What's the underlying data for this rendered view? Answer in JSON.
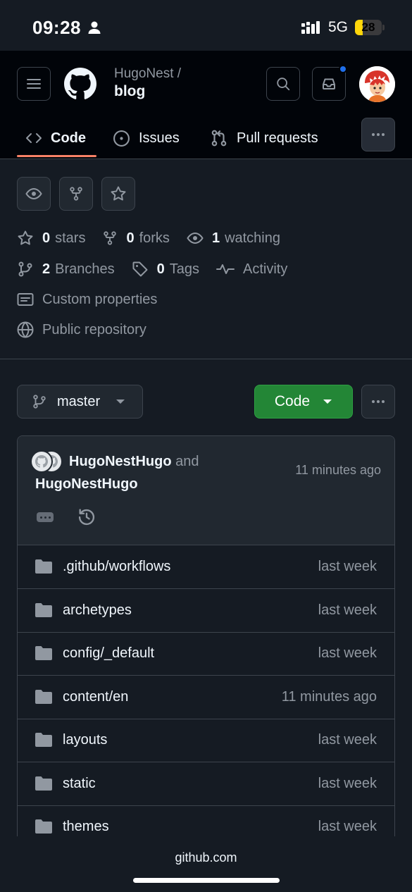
{
  "status_bar": {
    "time": "09:28",
    "network": "5G",
    "battery": "28",
    "battery_level": 0.28
  },
  "header": {
    "owner": "HugoNest /",
    "repo": "blog",
    "tabs": [
      {
        "label": "Code",
        "icon": "code-icon",
        "active": true
      },
      {
        "label": "Issues",
        "icon": "issue-icon",
        "active": false
      },
      {
        "label": "Pull requests",
        "icon": "pull-request-icon",
        "active": false
      }
    ],
    "notification_dot_color": "#1f6feb"
  },
  "repo_meta": {
    "stars_count": "0",
    "stars_label": "stars",
    "forks_count": "0",
    "forks_label": "forks",
    "watching_count": "1",
    "watching_label": "watching",
    "branches_count": "2",
    "branches_label": "Branches",
    "tags_count": "0",
    "tags_label": "Tags",
    "activity_label": "Activity",
    "custom_properties_label": "Custom properties",
    "visibility_label": "Public repository"
  },
  "branch": {
    "name": "master",
    "code_button": "Code",
    "code_button_color": "#238636"
  },
  "commit": {
    "author1": "HugoNestHugo",
    "conjunction": "and",
    "author2": "HugoNestHugo",
    "time": "11 minutes ago"
  },
  "files": [
    {
      "name": ".github/workflows",
      "time": "last week"
    },
    {
      "name": "archetypes",
      "time": "last week"
    },
    {
      "name": "config/_default",
      "time": "last week"
    },
    {
      "name": "content/en",
      "time": "11 minutes ago"
    },
    {
      "name": "layouts",
      "time": "last week"
    },
    {
      "name": "static",
      "time": "last week"
    },
    {
      "name": "themes",
      "time": "last week"
    }
  ],
  "bottom": {
    "url": "github.com"
  }
}
